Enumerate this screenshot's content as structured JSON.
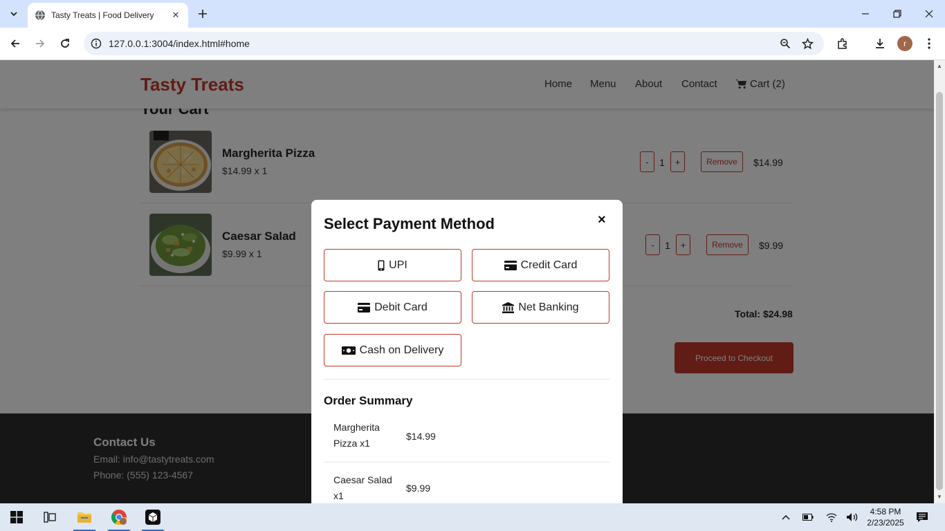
{
  "browser": {
    "tab_title": "Tasty Treats | Food Delivery",
    "url": "127.0.0.1:3004/index.html#home",
    "profile_initial": "r"
  },
  "site": {
    "logo": "Tasty Treats",
    "nav": [
      "Home",
      "Menu",
      "About",
      "Contact",
      "Cart (2)"
    ],
    "cart_heading": "Your Cart",
    "items": [
      {
        "name": "Margherita Pizza",
        "sub": "$14.99 x 1",
        "qty": "1",
        "price": "$14.99",
        "minus": "-",
        "plus": "+",
        "remove": "Remove"
      },
      {
        "name": "Caesar Salad",
        "sub": "$9.99 x 1",
        "qty": "1",
        "price": "$9.99",
        "minus": "-",
        "plus": "+",
        "remove": "Remove"
      }
    ],
    "total": "Total: $24.98",
    "checkout": "Proceed to Checkout",
    "footer": {
      "heading": "Contact Us",
      "email": "Email: info@tastytreats.com",
      "phone": "Phone: (555) 123-4567"
    }
  },
  "modal": {
    "title": "Select Payment Method",
    "close": "×",
    "methods": [
      {
        "label": "UPI",
        "icon": "mobile-icon"
      },
      {
        "label": "Credit Card",
        "icon": "credit-card-icon"
      },
      {
        "label": "Debit Card",
        "icon": "debit-card-icon"
      },
      {
        "label": "Net Banking",
        "icon": "bank-icon"
      },
      {
        "label": "Cash on Delivery",
        "icon": "cash-icon"
      }
    ],
    "summary_heading": "Order Summary",
    "summary": [
      {
        "name": "Margherita Pizza x1",
        "price": "$14.99"
      },
      {
        "name": "Caesar Salad x1",
        "price": "$9.99"
      }
    ]
  },
  "taskbar": {
    "time": "4:58 PM",
    "date": "2/23/2025"
  },
  "colors": {
    "brand": "#c0392b",
    "tab_strip": "#d3e3fd",
    "footer": "#2c2c2c"
  }
}
